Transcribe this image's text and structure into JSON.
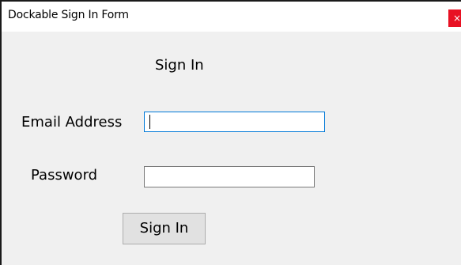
{
  "window": {
    "title": "Dockable Sign In Form",
    "close_label": "×"
  },
  "form": {
    "heading": "Sign In",
    "email_label": "Email Address",
    "email_value": "",
    "password_label": "Password",
    "password_value": "",
    "submit_label": "Sign In"
  },
  "colors": {
    "close_button": "#e81123",
    "focus_border": "#0078d7",
    "background": "#f0f0f0"
  }
}
